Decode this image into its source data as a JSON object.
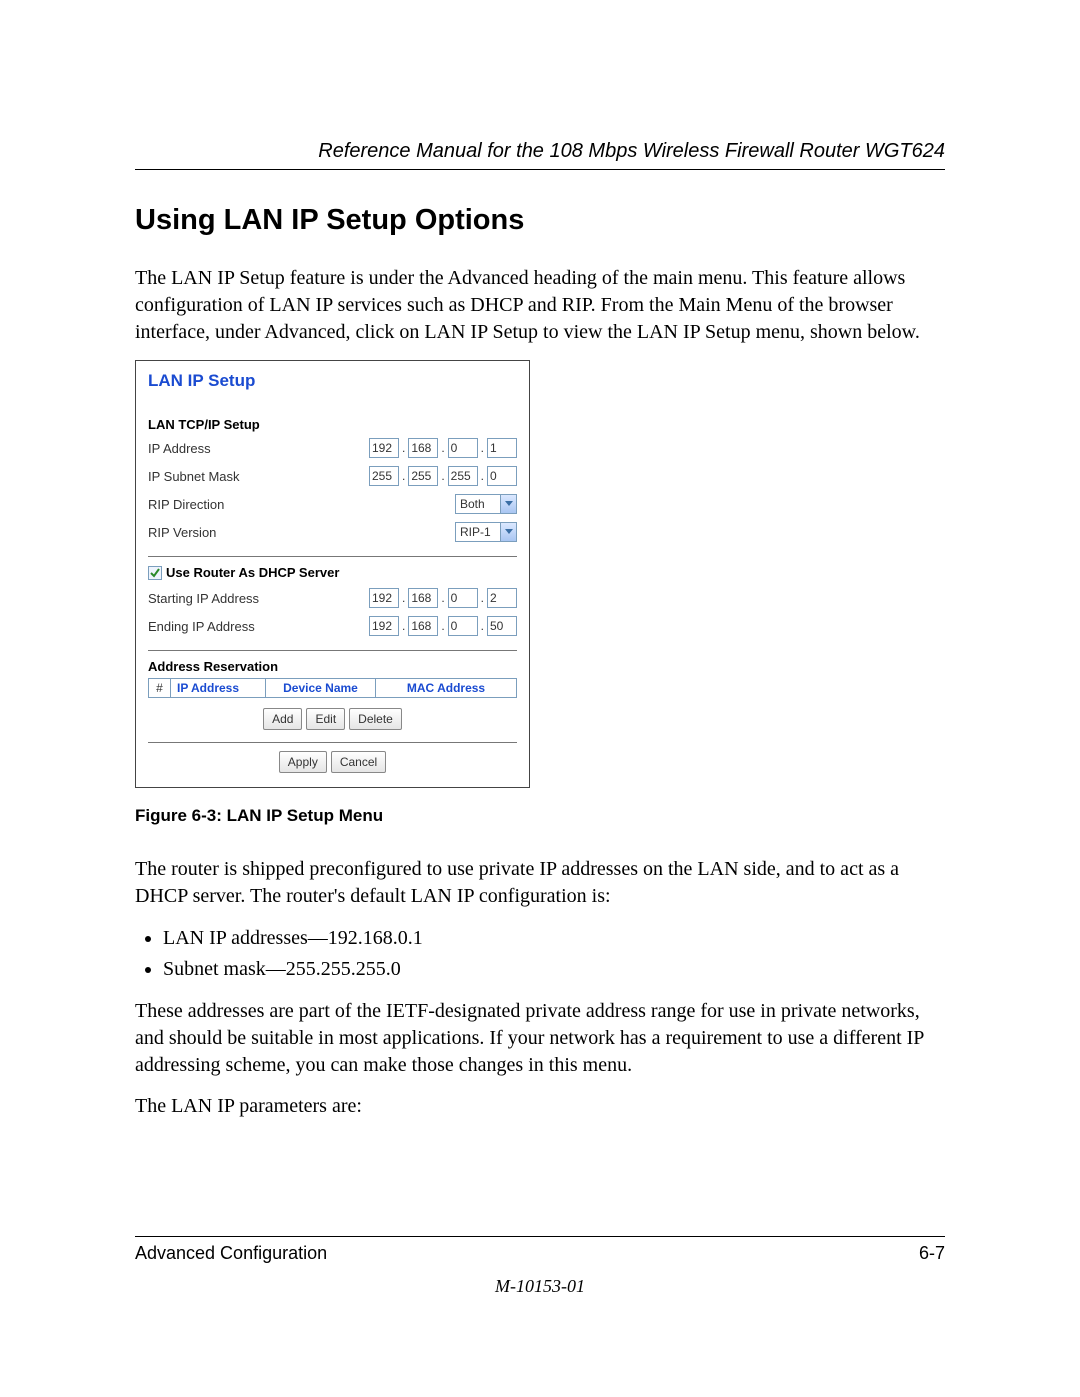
{
  "header": {
    "manual_title": "Reference Manual for the 108 Mbps Wireless Firewall Router WGT624"
  },
  "section_heading": "Using LAN IP Setup Options",
  "intro_para": "The LAN IP Setup feature is under the Advanced heading of the main menu. This feature allows configuration of LAN IP services such as DHCP and RIP. From the Main Menu of the browser interface, under Advanced, click on LAN IP Setup to view the LAN IP Setup menu, shown below.",
  "screenshot": {
    "title": "LAN IP Setup",
    "tcpip_label": "LAN TCP/IP Setup",
    "rows": {
      "ip_address_label": "IP Address",
      "ip_address": [
        "192",
        "168",
        "0",
        "1"
      ],
      "subnet_label": "IP Subnet Mask",
      "subnet": [
        "255",
        "255",
        "255",
        "0"
      ],
      "rip_dir_label": "RIP Direction",
      "rip_dir_value": "Both",
      "rip_ver_label": "RIP Version",
      "rip_ver_value": "RIP-1"
    },
    "dhcp": {
      "checkbox_label": "Use Router As DHCP Server",
      "start_label": "Starting IP Address",
      "start": [
        "192",
        "168",
        "0",
        "2"
      ],
      "end_label": "Ending IP Address",
      "end": [
        "192",
        "168",
        "0",
        "50"
      ]
    },
    "reservation": {
      "heading": "Address Reservation",
      "cols": {
        "c1": "#",
        "c2": "IP Address",
        "c3": "Device Name",
        "c4": "MAC Address"
      },
      "buttons": {
        "add": "Add",
        "edit": "Edit",
        "del": "Delete"
      }
    },
    "actions": {
      "apply": "Apply",
      "cancel": "Cancel"
    }
  },
  "figure_caption": "Figure 6-3:  LAN IP Setup Menu",
  "para_after_fig": "The router is shipped preconfigured to use private IP addresses on the LAN side, and to act as a DHCP server. The router's default LAN IP configuration is:",
  "bullets": [
    "LAN IP addresses—192.168.0.1",
    "Subnet mask—255.255.255.0"
  ],
  "para_ietf": "These addresses are part of the IETF-designated private address range for use in private networks, and should be suitable in most applications. If your network has a requirement to use a different IP addressing scheme, you can make those changes in this menu.",
  "para_params": "The LAN IP parameters are:",
  "footer": {
    "left": "Advanced Configuration",
    "right": "6-7",
    "docnum": "M-10153-01"
  }
}
